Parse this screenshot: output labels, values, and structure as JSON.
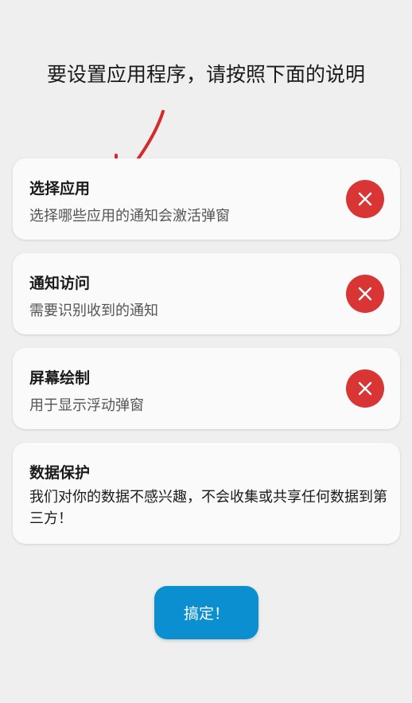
{
  "headline": "要设置应用程序，请按照下面的说明",
  "cards": [
    {
      "title": "选择应用",
      "desc": "选择哪些应用的通知会激活弹窗",
      "status": "not-granted",
      "icon": "close-icon"
    },
    {
      "title": "通知访问",
      "desc": "需要识别收到的通知",
      "status": "not-granted",
      "icon": "close-icon"
    },
    {
      "title": "屏幕绘制",
      "desc": "用于显示浮动弹窗",
      "status": "not-granted",
      "icon": "close-icon"
    },
    {
      "title": "数据保护",
      "desc": "我们对你的数据不感兴趣，不会收集或共享任何数据到第三方！"
    }
  ],
  "done_button": "搞定！",
  "colors": {
    "background": "#efefef",
    "card": "#fafafa",
    "error_red": "#d93535",
    "accent_blue": "#0b8fd1",
    "annotation_arrow": "#d42a2a"
  }
}
